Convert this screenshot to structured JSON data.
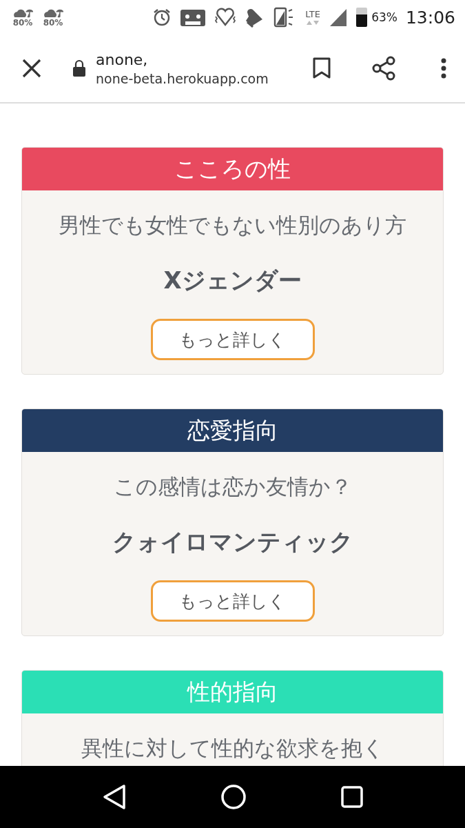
{
  "status_bar": {
    "weather": [
      {
        "reading": "80%"
      },
      {
        "reading": "80%"
      }
    ],
    "lte": "LTE",
    "battery": "63%",
    "time": "13:06"
  },
  "browser_bar": {
    "title": "anone,",
    "url": "none-beta.herokuapp.com"
  },
  "cards": [
    {
      "title": "こころの性",
      "color": "#e84a5f",
      "description": "男性でも女性でもない性別のあり方",
      "term": "Xジェンダー",
      "button": "もっと詳しく"
    },
    {
      "title": "恋愛指向",
      "color": "#233d63",
      "description": "この感情は恋か友情か？",
      "term": "クォイロマンティック",
      "button": "もっと詳しく"
    },
    {
      "title": "性的指向",
      "color": "#2bdfb5",
      "description": "異性に対して性的な欲求を抱く"
    }
  ]
}
